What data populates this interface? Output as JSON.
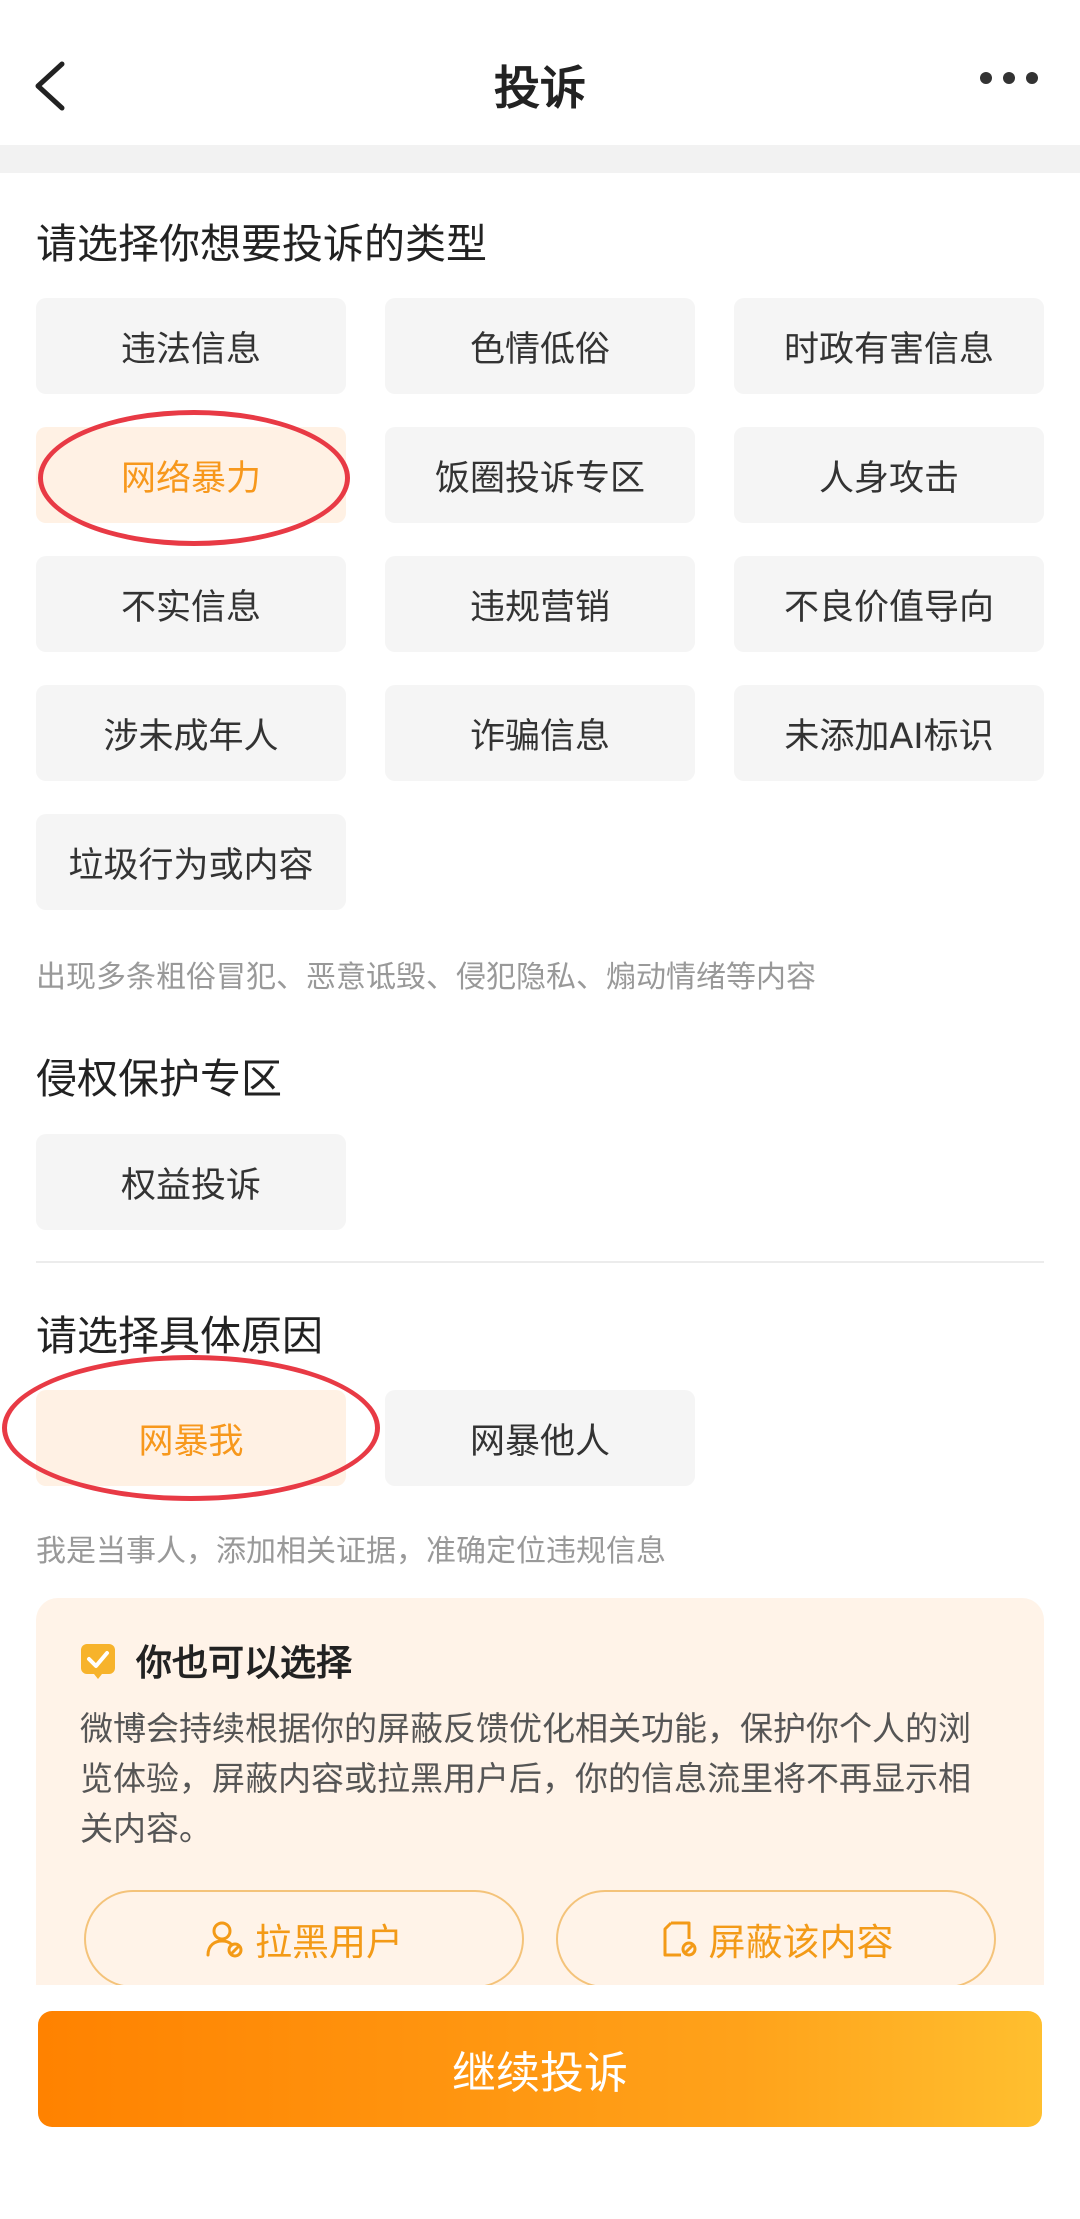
{
  "header": {
    "title": "投诉"
  },
  "complaint_type": {
    "title": "请选择你想要投诉的类型",
    "options": [
      "违法信息",
      "色情低俗",
      "时政有害信息",
      "网络暴力",
      "饭圈投诉专区",
      "人身攻击",
      "不实信息",
      "违规营销",
      "不良价值导向",
      "涉未成年人",
      "诈骗信息",
      "未添加AI标识",
      "垃圾行为或内容"
    ],
    "selected": "网络暴力",
    "hint": "出现多条粗俗冒犯、恶意诋毁、侵犯隐私、煽动情绪等内容"
  },
  "rights": {
    "title": "侵权保护专区",
    "option": "权益投诉"
  },
  "reason": {
    "title": "请选择具体原因",
    "options": [
      "网暴我",
      "网暴他人"
    ],
    "selected": "网暴我",
    "hint": "我是当事人，添加相关证据，准确定位违规信息"
  },
  "alt_card": {
    "title": "你也可以选择",
    "body": "微博会持续根据你的屏蔽反馈优化相关功能，保护你个人的浏览体验，屏蔽内容或拉黑用户后，你的信息流里将不再显示相关内容。",
    "block_user": "拉黑用户",
    "hide_content": "屏蔽该内容"
  },
  "submit_label": "继续投诉",
  "colors": {
    "accent": "#f7981c",
    "annotation_circle": "#e83a45",
    "chip_bg": "#f5f5f5"
  }
}
